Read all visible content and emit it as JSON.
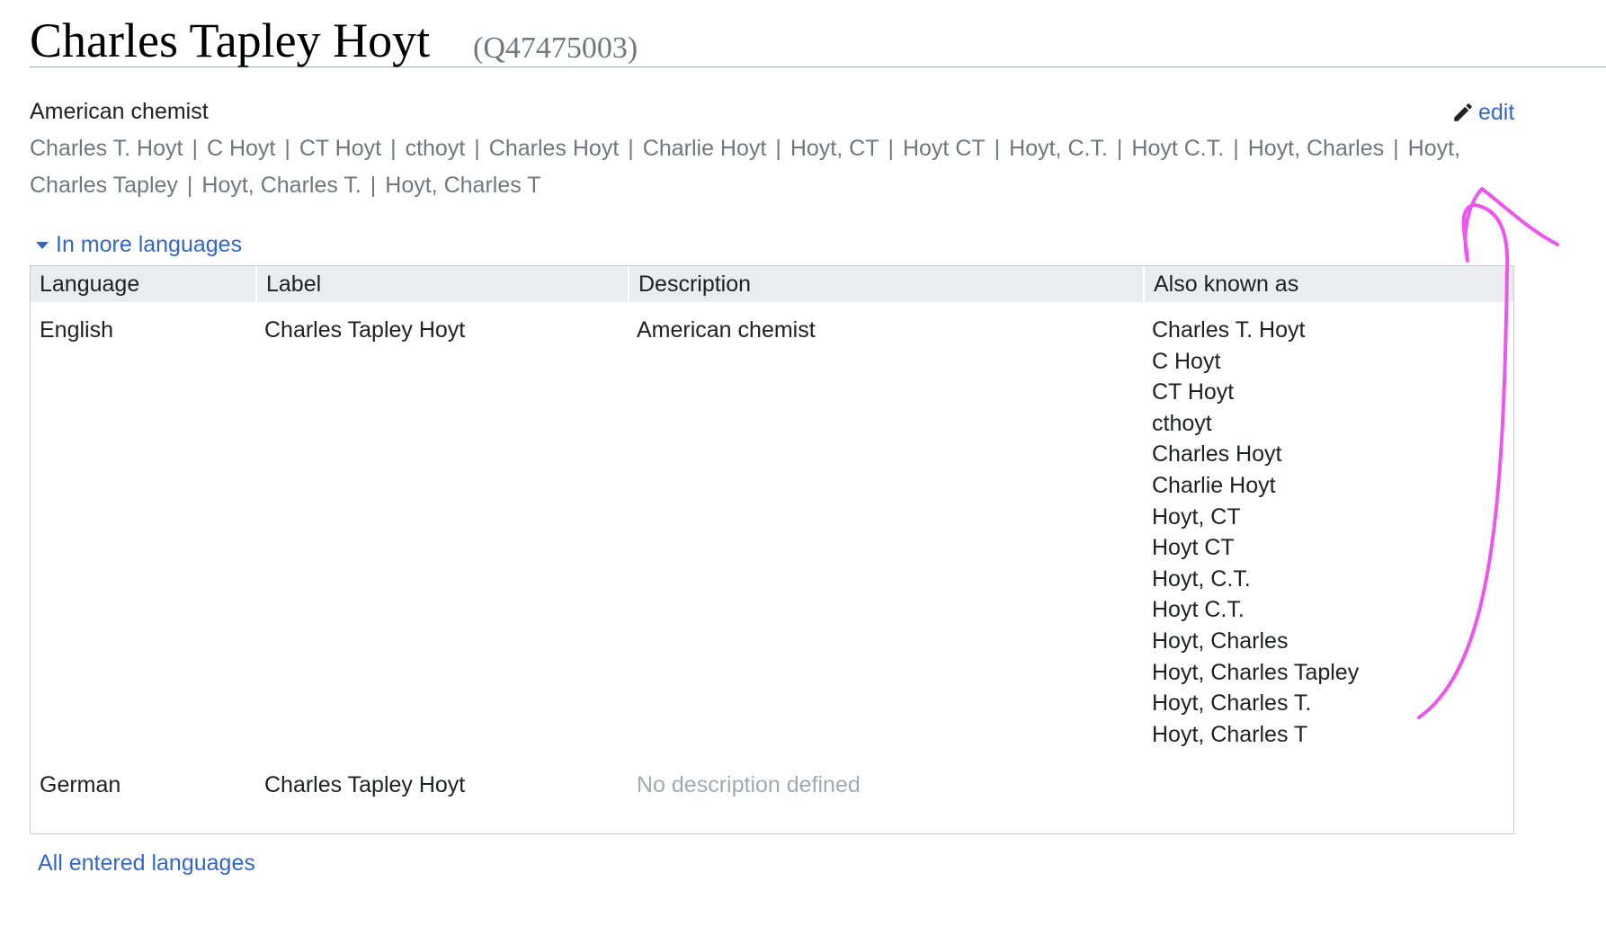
{
  "header": {
    "title": "Charles Tapley Hoyt",
    "qid": "(Q47475003)"
  },
  "summary": {
    "description": "American chemist",
    "edit_label": "edit",
    "aliases": [
      "Charles T. Hoyt",
      "C Hoyt",
      "CT Hoyt",
      "cthoyt",
      "Charles Hoyt",
      "Charlie Hoyt",
      "Hoyt, CT",
      "Hoyt CT",
      "Hoyt, C.T.",
      "Hoyt C.T.",
      "Hoyt, Charles",
      "Hoyt, Charles Tapley",
      "Hoyt, Charles T.",
      "Hoyt, Charles T"
    ],
    "alias_separator": "|"
  },
  "languages": {
    "toggle_label": "In more languages",
    "columns": [
      "Language",
      "Label",
      "Description",
      "Also known as"
    ],
    "rows": [
      {
        "language": "English",
        "label": "Charles Tapley Hoyt",
        "description": "American chemist",
        "description_missing": false,
        "aliases": [
          "Charles T. Hoyt",
          "C Hoyt",
          "CT Hoyt",
          "cthoyt",
          "Charles Hoyt",
          "Charlie Hoyt",
          "Hoyt, CT",
          "Hoyt CT",
          "Hoyt, C.T.",
          "Hoyt C.T.",
          "Hoyt, Charles",
          "Hoyt, Charles Tapley",
          "Hoyt, Charles T.",
          "Hoyt, Charles T"
        ]
      },
      {
        "language": "German",
        "label": "Charles Tapley Hoyt",
        "description": "No description defined",
        "description_missing": true,
        "aliases": []
      }
    ],
    "all_languages_label": "All entered languages"
  },
  "colors": {
    "link": "#3366cc",
    "muted_text": "#72777d",
    "placeholder_text": "#a2a9b1",
    "header_bg": "#eaecf0",
    "annotation": "#ee55ee"
  },
  "icons": {
    "edit": "pencil-icon",
    "toggle": "triangle-down-icon"
  }
}
